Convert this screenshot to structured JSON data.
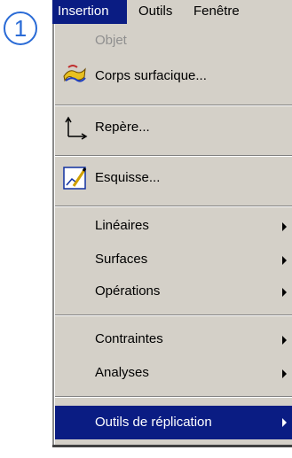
{
  "callout": "1",
  "menubar": {
    "items": [
      {
        "label": "Insertion"
      },
      {
        "label": "Outils"
      },
      {
        "label": "Fenêtre"
      }
    ]
  },
  "menu": {
    "items": [
      {
        "label": "Objet",
        "enabled": false
      },
      {
        "label": "Corps surfacique...",
        "icon": "surface-body-icon"
      },
      {
        "label": "Repère...",
        "icon": "axis-system-icon"
      },
      {
        "label": "Esquisse...",
        "icon": "sketch-icon"
      },
      {
        "label": "Linéaires",
        "submenu": true
      },
      {
        "label": "Surfaces",
        "submenu": true
      },
      {
        "label": "Opérations",
        "submenu": true
      },
      {
        "label": "Contraintes",
        "submenu": true
      },
      {
        "label": "Analyses",
        "submenu": true
      },
      {
        "label": "Outils de réplication",
        "submenu": true,
        "highlighted": true
      }
    ]
  },
  "colors": {
    "highlight": "#0a1c83",
    "menu_bg": "#d4d0c8",
    "callout": "#2a6bd6"
  }
}
